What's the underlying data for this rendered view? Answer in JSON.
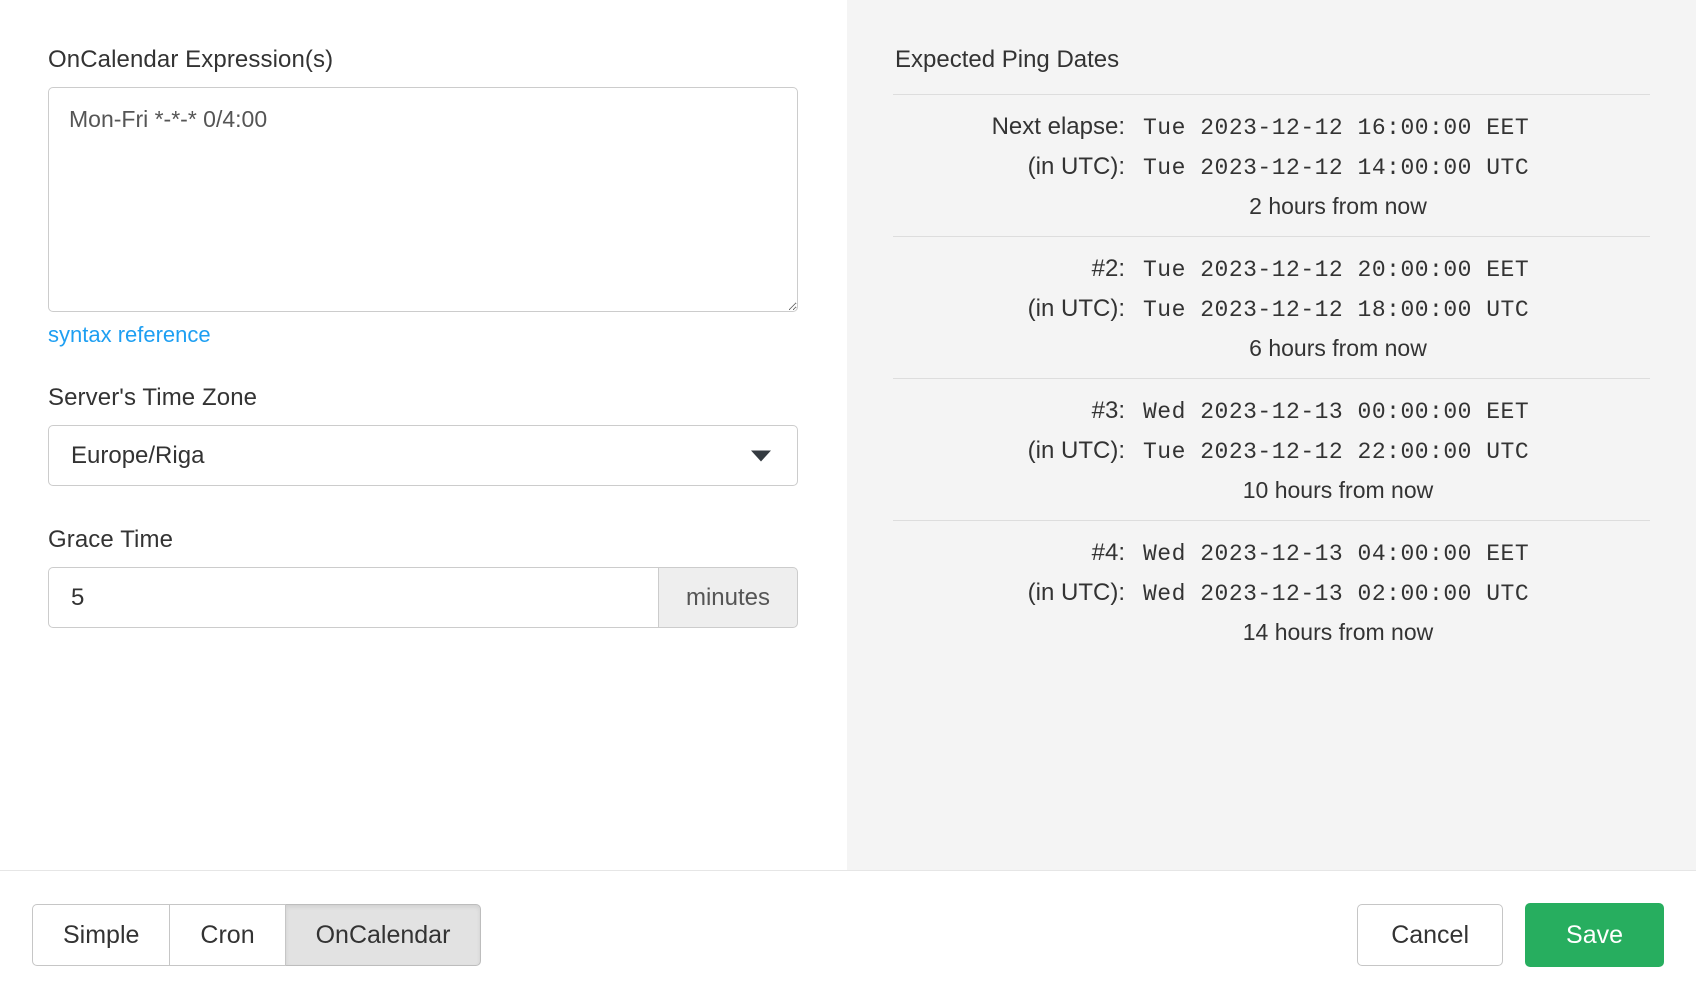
{
  "form": {
    "expression_label": "OnCalendar Expression(s)",
    "expression_value": "Mon-Fri *-*-* 0/4:00",
    "expression_placeholder": "Mon-Fri *-*-* 0/4:00",
    "syntax_link": "syntax reference",
    "timezone_label": "Server's Time Zone",
    "timezone_value": "Europe/Riga",
    "grace_label": "Grace Time",
    "grace_value": "5",
    "grace_unit": "minutes"
  },
  "preview": {
    "title": "Expected Ping Dates",
    "rows": [
      {
        "label": "Next elapse:",
        "local": "Tue 2023-12-12 16:00:00 EET",
        "utc_label": "(in UTC):",
        "utc": "Tue 2023-12-12 14:00:00 UTC",
        "relative": "2 hours from now"
      },
      {
        "label": "#2:",
        "local": "Tue 2023-12-12 20:00:00 EET",
        "utc_label": "(in UTC):",
        "utc": "Tue 2023-12-12 18:00:00 UTC",
        "relative": "6 hours from now"
      },
      {
        "label": "#3:",
        "local": "Wed 2023-12-13 00:00:00 EET",
        "utc_label": "(in UTC):",
        "utc": "Tue 2023-12-12 22:00:00 UTC",
        "relative": "10 hours from now"
      },
      {
        "label": "#4:",
        "local": "Wed 2023-12-13 04:00:00 EET",
        "utc_label": "(in UTC):",
        "utc": "Wed 2023-12-13 02:00:00 UTC",
        "relative": "14 hours from now"
      }
    ]
  },
  "footer": {
    "tabs": [
      {
        "label": "Simple",
        "active": false
      },
      {
        "label": "Cron",
        "active": false
      },
      {
        "label": "OnCalendar",
        "active": true
      }
    ],
    "cancel_label": "Cancel",
    "save_label": "Save"
  },
  "colors": {
    "accent_link": "#1e9ff2",
    "save_green": "#27ae5f",
    "panel_bg": "#f4f4f4",
    "active_tab_bg": "#e2e2e2"
  }
}
